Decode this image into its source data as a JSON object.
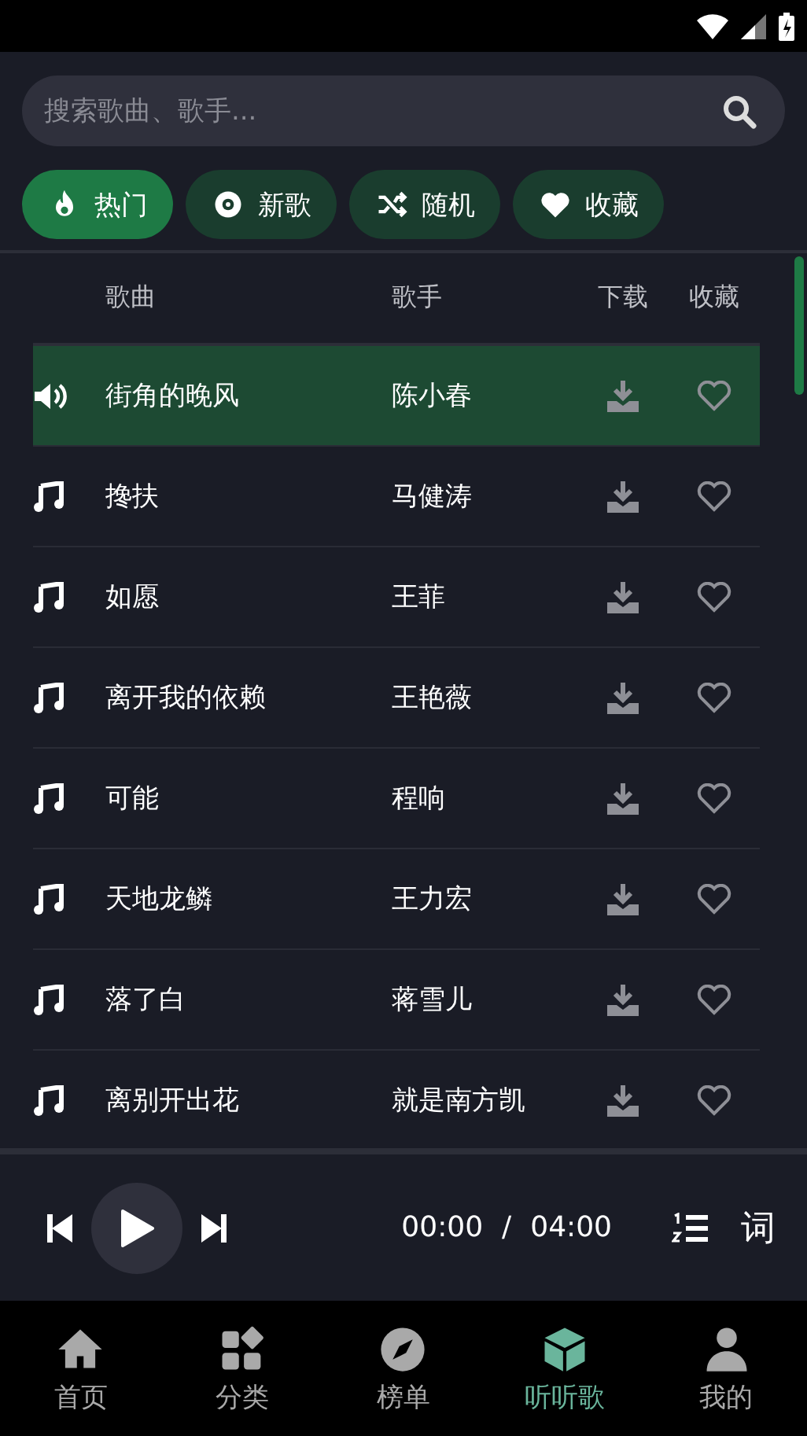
{
  "search": {
    "placeholder": "搜索歌曲、歌手..."
  },
  "chips": [
    {
      "kind": "fire",
      "label": "热门",
      "selected": true
    },
    {
      "kind": "disc",
      "label": "新歌",
      "selected": false
    },
    {
      "kind": "shuffle",
      "label": "随机",
      "selected": false
    },
    {
      "kind": "heart",
      "label": "收藏",
      "selected": false
    }
  ],
  "table": {
    "columns": [
      "歌曲",
      "歌手",
      "下载",
      "收藏"
    ],
    "rows": [
      {
        "title": "街角的晚风",
        "artist": "陈小春",
        "selected": true
      },
      {
        "title": "搀扶",
        "artist": "马健涛",
        "selected": false
      },
      {
        "title": "如愿",
        "artist": "王菲",
        "selected": false
      },
      {
        "title": "离开我的依赖",
        "artist": "王艳薇",
        "selected": false
      },
      {
        "title": "可能",
        "artist": "程响",
        "selected": false
      },
      {
        "title": "天地龙鳞",
        "artist": "王力宏",
        "selected": false
      },
      {
        "title": "落了白",
        "artist": "蒋雪儿",
        "selected": false
      },
      {
        "title": "离别开出花",
        "artist": "就是南方凯",
        "selected": false
      }
    ]
  },
  "player": {
    "elapsed": "00:00",
    "separator": "/",
    "duration": "04:00",
    "lyrics": "词"
  },
  "nav": [
    {
      "kind": "home",
      "label": "首页",
      "selected": false
    },
    {
      "kind": "grid",
      "label": "分类",
      "selected": false
    },
    {
      "kind": "compass",
      "label": "榜单",
      "selected": false
    },
    {
      "kind": "cube",
      "label": "听听歌",
      "selected": true
    },
    {
      "kind": "person",
      "label": "我的",
      "selected": false
    }
  ]
}
